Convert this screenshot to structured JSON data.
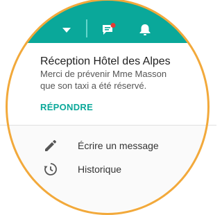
{
  "header": {
    "icons": [
      "chevron-down-icon",
      "chat-icon",
      "notification-bell-icon"
    ],
    "unread_dot_color": "#e53935",
    "background_color": "#0aa89a"
  },
  "notification": {
    "title": "Réception Hôtel des Alpes",
    "body": "Merci de prévenir Mme Masson que son taxi a été réservé.",
    "reply_label": "RÉPONDRE"
  },
  "actions": [
    {
      "icon": "pencil-icon",
      "label": "Écrire un message"
    },
    {
      "icon": "history-icon",
      "label": "Historique"
    }
  ],
  "colors": {
    "accent": "#0aa89a",
    "ring": "#f2a93b"
  }
}
